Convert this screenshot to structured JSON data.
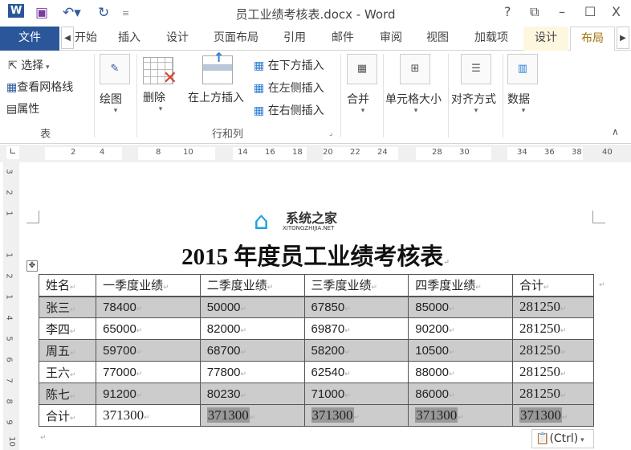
{
  "window": {
    "title": "员工业绩考核表.docx - Word",
    "help": "?",
    "restore": "⧉",
    "minimize": "–",
    "maximize": "☐",
    "close": "X"
  },
  "tabs": [
    "文件",
    "开始",
    "插入",
    "设计",
    "页面布局",
    "引用",
    "邮件",
    "审阅",
    "视图",
    "加载项",
    "设计",
    "布局"
  ],
  "ribbon": {
    "table_group": {
      "select": "选择",
      "gridlines": "查看网格线",
      "properties": "属性",
      "label": "表"
    },
    "draw": "绘图",
    "delete": "删除",
    "insert_above": "在上方插入",
    "insert_below": "在下方插入",
    "insert_left": "在左侧插入",
    "insert_right": "在右侧插入",
    "rows_cols_label": "行和列",
    "merge": "合并",
    "cell_size": "单元格大小",
    "alignment": "对齐方式",
    "data": "数据"
  },
  "ruler": {
    "h": [
      "2",
      "4",
      "8",
      "10",
      "14",
      "16",
      "18",
      "20",
      "22",
      "24",
      "28",
      "30",
      "34",
      "36",
      "38",
      "40"
    ],
    "v": [
      "3",
      "2",
      "1",
      "1",
      "2",
      "1",
      "4",
      "5",
      "6",
      "7",
      "8",
      "9",
      "10"
    ]
  },
  "watermark": {
    "name": "系统之家",
    "url": "XITONGZHIJIA.NET"
  },
  "document": {
    "title": "2015 年度员工业绩考核表",
    "headers": [
      "姓名",
      "一季度业绩",
      "二季度业绩",
      "三季度业绩",
      "四季度业绩",
      "合计"
    ],
    "rows": [
      [
        "张三",
        "78400",
        "50000",
        "67850",
        "85000",
        "281250"
      ],
      [
        "李四",
        "65000",
        "82000",
        "69870",
        "90200",
        "281250"
      ],
      [
        "周五",
        "59700",
        "68700",
        "58200",
        "10500",
        "281250"
      ],
      [
        "王六",
        "77000",
        "77800",
        "62540",
        "88000",
        "281250"
      ],
      [
        "陈七",
        "91200",
        "80230",
        "71000",
        "86000",
        "281250"
      ]
    ],
    "total": [
      "合计",
      "371300",
      "371300",
      "371300",
      "371300",
      "371300"
    ]
  },
  "paste_options": "(Ctrl)"
}
